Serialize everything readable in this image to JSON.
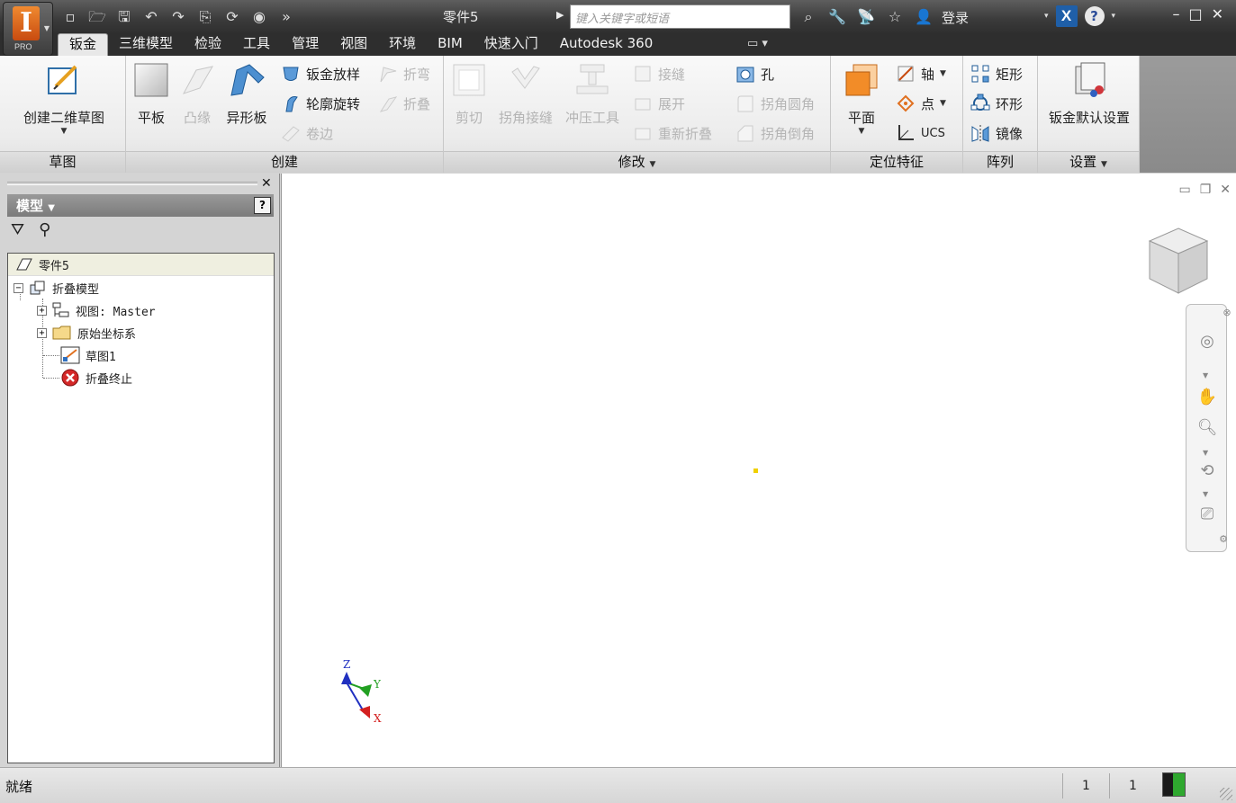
{
  "app": {
    "title": "零件5",
    "logo_letter": "I",
    "edition": "PRO",
    "search_placeholder": "键入关键字或短语",
    "login_label": "登录"
  },
  "tabs": [
    {
      "label": "钣金",
      "active": true
    },
    {
      "label": "三维模型"
    },
    {
      "label": "检验"
    },
    {
      "label": "工具"
    },
    {
      "label": "管理"
    },
    {
      "label": "视图"
    },
    {
      "label": "环境"
    },
    {
      "label": "BIM"
    },
    {
      "label": "快速入门"
    },
    {
      "label": "Autodesk 360"
    }
  ],
  "ribbon": {
    "sketch": {
      "title": "草图",
      "create_sketch": "创建二维草图"
    },
    "create": {
      "title": "创建",
      "face": "平板",
      "contour_flange": "凸缘",
      "contour_roll": "异形板",
      "lofted_flange": "钣金放样",
      "contour_rotate": "轮廓旋转",
      "hem": "卷边",
      "fold": "折弯",
      "fold2": "折叠"
    },
    "modify": {
      "title": "修改",
      "cut": "剪切",
      "corner_seam": "拐角接缝",
      "punch_tool": "冲压工具",
      "rip": "接缝",
      "unfold": "展开",
      "refold": "重新折叠",
      "hole": "孔",
      "corner_round": "拐角圆角",
      "corner_chamfer": "拐角倒角"
    },
    "work_features": {
      "title": "定位特征",
      "plane": "平面",
      "axis": "轴",
      "point": "点",
      "ucs": "UCS"
    },
    "pattern": {
      "title": "阵列",
      "rectangular": "矩形",
      "circular": "环形",
      "mirror": "镜像"
    },
    "setup": {
      "title": "设置",
      "defaults": "钣金默认设置"
    }
  },
  "browser": {
    "header": "模型",
    "tree": {
      "root": "零件5",
      "folded_model": "折叠模型",
      "view_master": "视图: Master",
      "origin": "原始坐标系",
      "sketch1": "草图1",
      "end_of_folded": "折叠终止"
    }
  },
  "viewport": {
    "axis_x": "X",
    "axis_y": "Y",
    "axis_z": "Z"
  },
  "status": {
    "text": "就绪",
    "count1": "1",
    "count2": "1"
  },
  "colors": {
    "accent_orange": "#f08a30",
    "autodesk_blue": "#1f5fa8",
    "axis_x": "#d42020",
    "axis_y": "#22a022",
    "axis_z": "#2030c0"
  }
}
